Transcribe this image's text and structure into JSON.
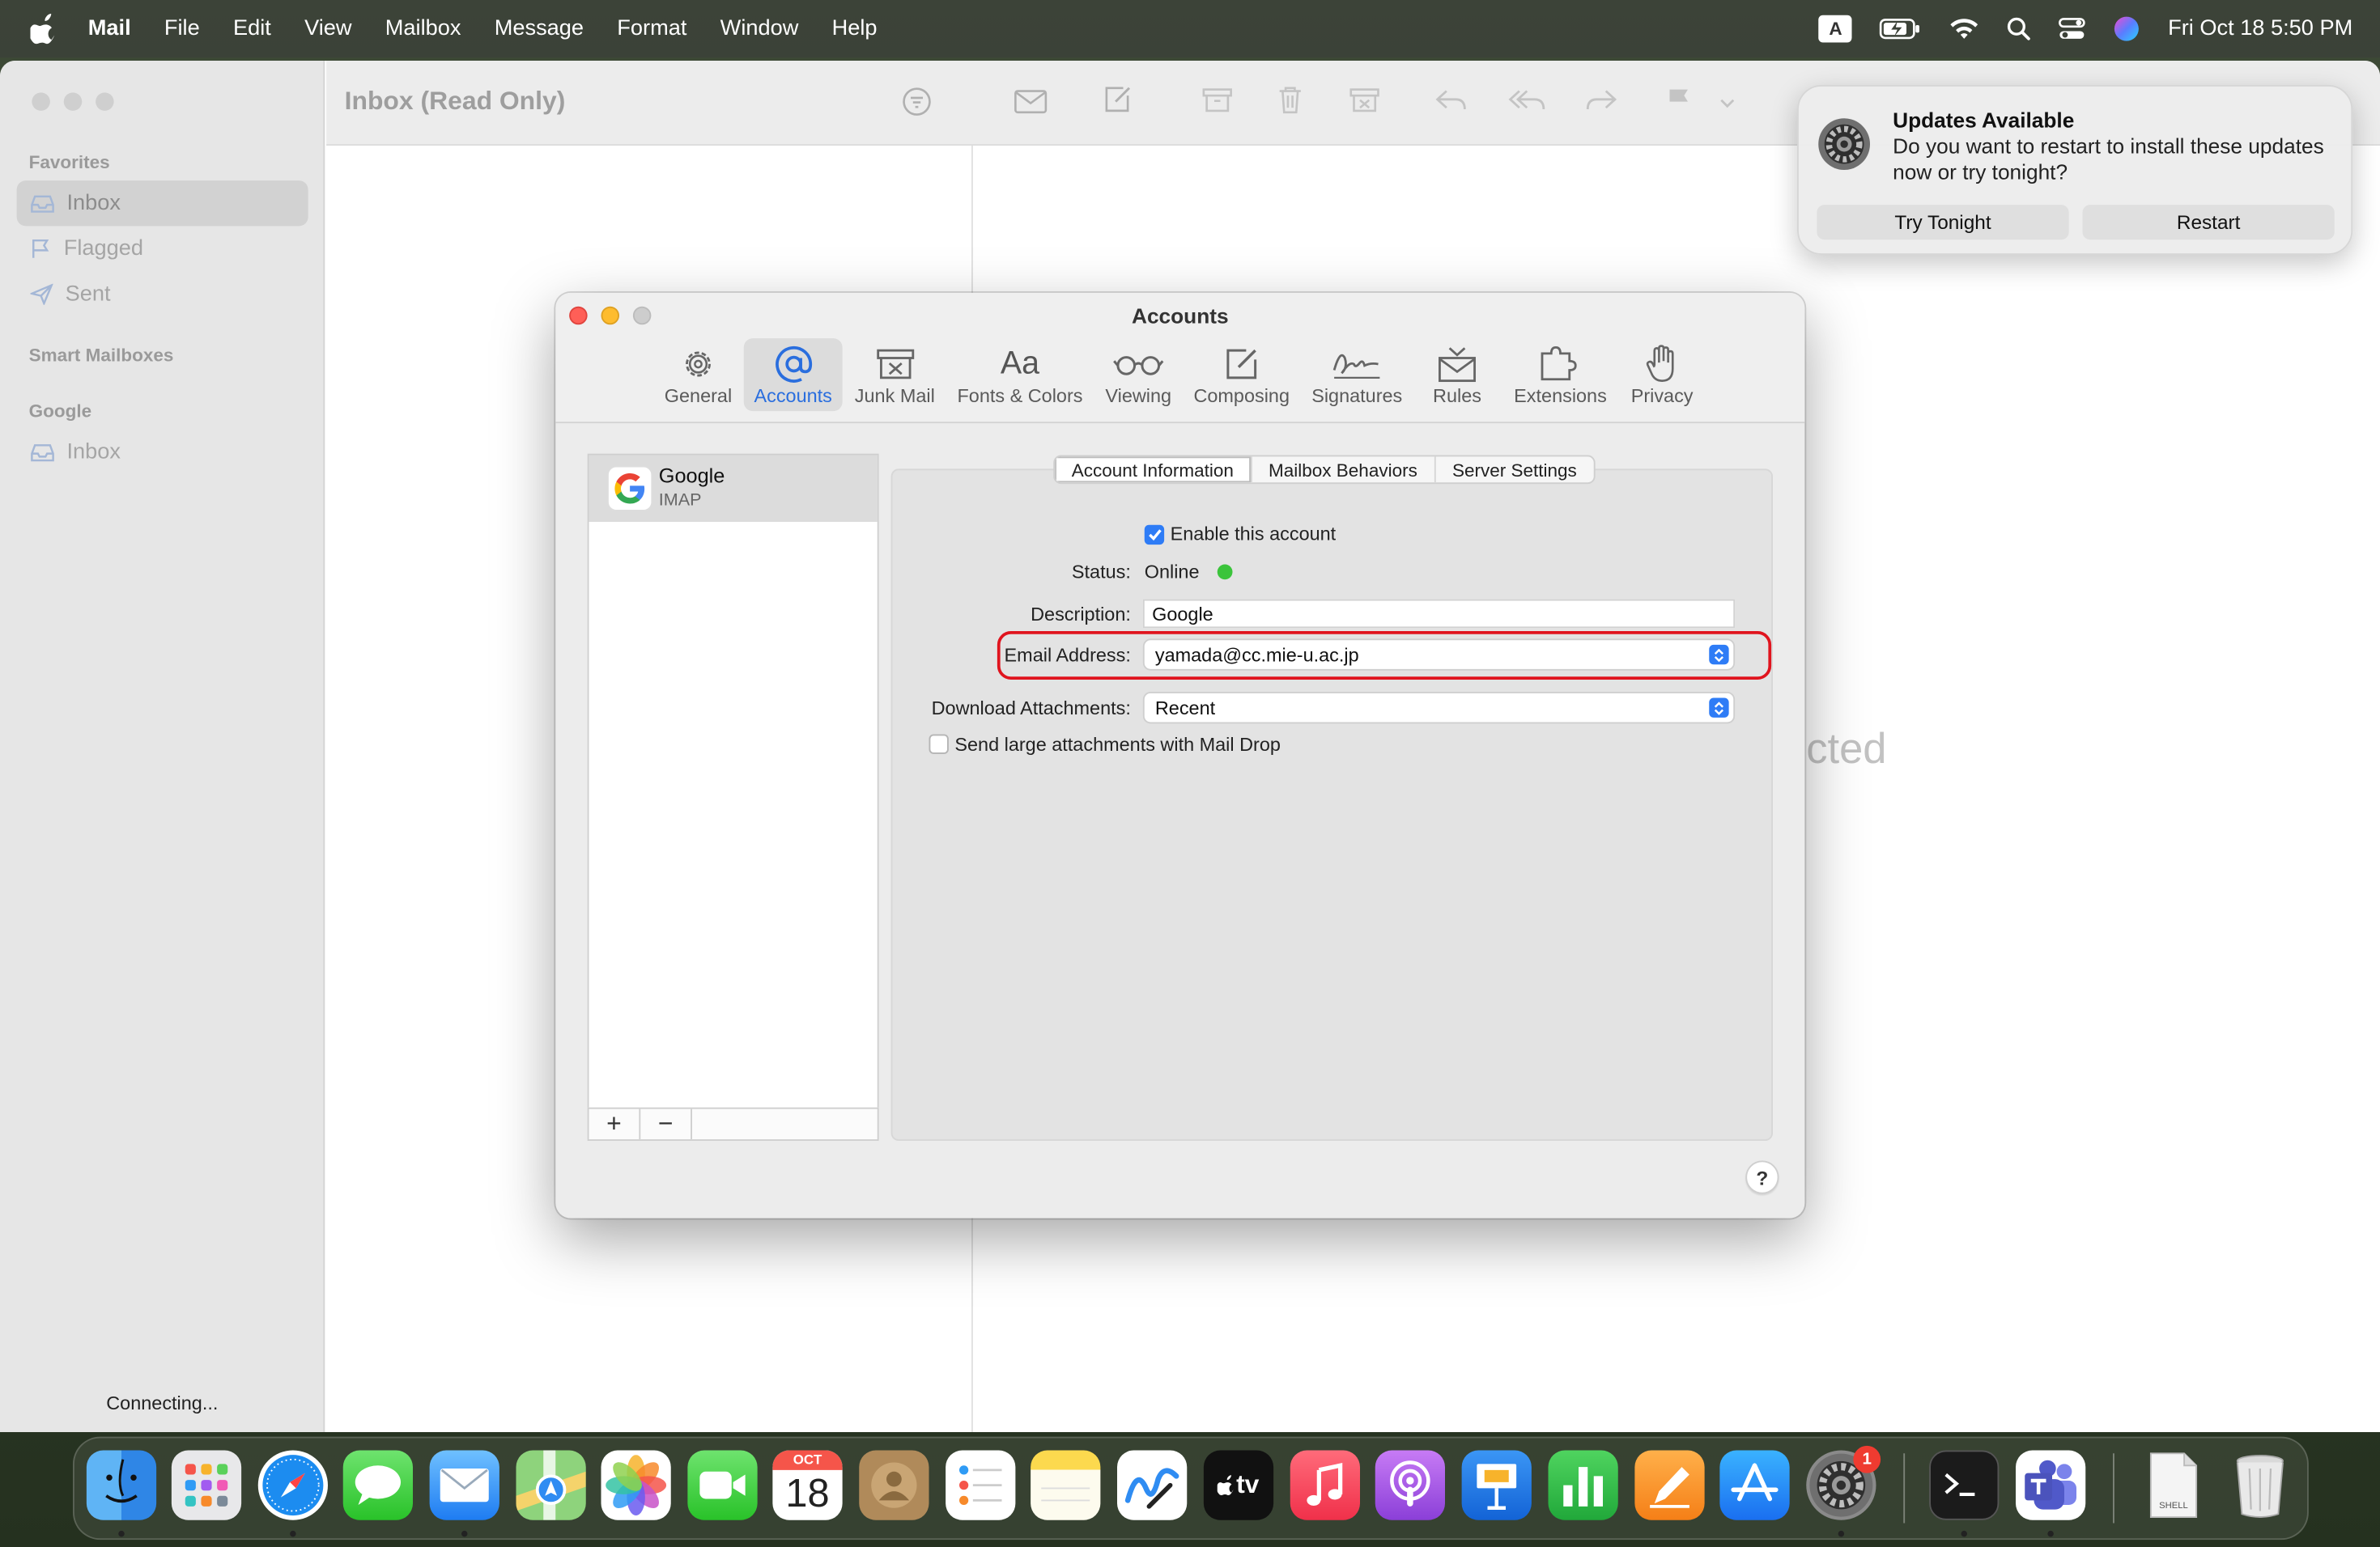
{
  "menubar": {
    "app": "Mail",
    "items": [
      "File",
      "Edit",
      "View",
      "Mailbox",
      "Message",
      "Format",
      "Window",
      "Help"
    ],
    "input_indicator": "A",
    "clock": "Fri Oct 18  5:50 PM",
    "icons": [
      "apple-icon",
      "battery-icon",
      "wifi-icon",
      "spotlight-icon",
      "control-center-icon",
      "siri-icon"
    ]
  },
  "mail": {
    "title": "Inbox (Read Only)",
    "sidebar": {
      "favorites_header": "Favorites",
      "favorites": [
        "Inbox",
        "Flagged",
        "Sent"
      ],
      "smart_header": "Smart Mailboxes",
      "google_header": "Google",
      "google_items": [
        "Inbox"
      ]
    },
    "status": "Connecting...",
    "no_selection_fragment": "cted"
  },
  "notification": {
    "title": "Updates Available",
    "message": "Do you want to restart to install these updates now or try tonight?",
    "buttons": [
      "Try Tonight",
      "Restart"
    ]
  },
  "dialog": {
    "title": "Accounts",
    "tabs": [
      "General",
      "Accounts",
      "Junk Mail",
      "Fonts & Colors",
      "Viewing",
      "Composing",
      "Signatures",
      "Rules",
      "Extensions",
      "Privacy"
    ],
    "selected_tab": "Accounts",
    "account": {
      "name": "Google",
      "type": "IMAP"
    },
    "list_buttons": [
      "+",
      "−"
    ],
    "segments": [
      "Account Information",
      "Mailbox Behaviors",
      "Server Settings"
    ],
    "selected_segment": "Account Information",
    "form": {
      "enable_label": "Enable this account",
      "enable_checked": true,
      "status_label": "Status:",
      "status_value": "Online",
      "status_color": "#3bc43b",
      "description_label": "Description:",
      "description_value": "Google",
      "email_label": "Email Address:",
      "email_value": "yamada@cc.mie-u.ac.jp",
      "download_label": "Download Attachments:",
      "download_value": "Recent",
      "maildrop_label": "Send large attachments with Mail Drop",
      "maildrop_checked": false
    },
    "help": "?"
  },
  "dock": {
    "apps": [
      "Finder",
      "Launchpad",
      "Safari",
      "Messages",
      "Mail",
      "Maps",
      "Photos",
      "FaceTime",
      "Calendar",
      "Contacts",
      "Reminders",
      "Notes",
      "Freeform",
      "TV",
      "Music",
      "Podcasts",
      "Keynote",
      "Numbers",
      "Pages",
      "App Store",
      "System Settings",
      "Terminal",
      "Teams",
      "Shell",
      "Trash"
    ],
    "calendar_month": "OCT",
    "calendar_day": "18",
    "tv_label": "tv",
    "settings_badge": "1",
    "shell_label": "SHELL"
  }
}
